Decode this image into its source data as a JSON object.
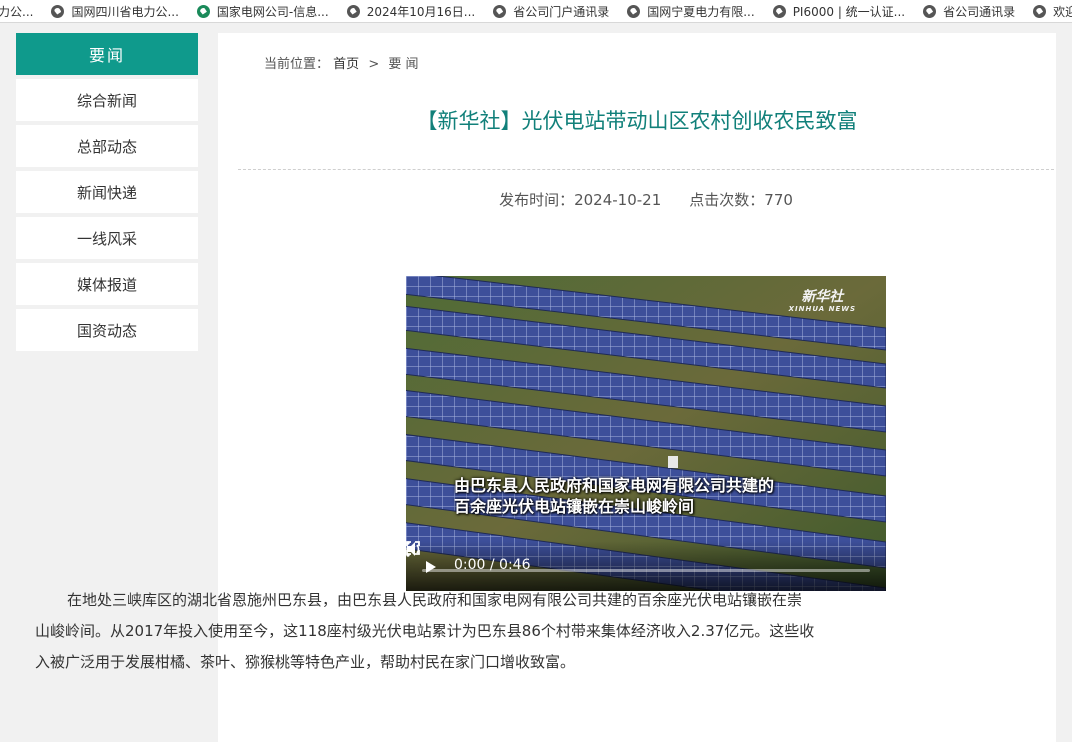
{
  "bookmarks": [
    {
      "label": "力公...",
      "icon": "globe-icon"
    },
    {
      "label": "国网四川省电力公...",
      "icon": "globe-icon"
    },
    {
      "label": "国家电网公司-信息...",
      "icon": "sgcc-logo-icon"
    },
    {
      "label": "2024年10月16日...",
      "icon": "globe-icon"
    },
    {
      "label": "省公司门户通讯录",
      "icon": "globe-icon"
    },
    {
      "label": "国网宁夏电力有限...",
      "icon": "globe-icon"
    },
    {
      "label": "PI6000 | 统一认证...",
      "icon": "globe-icon"
    },
    {
      "label": "省公司通讯录",
      "icon": "globe-icon"
    },
    {
      "label": "欢迎",
      "icon": "globe-icon"
    }
  ],
  "sidebar": {
    "header": "要闻",
    "items": [
      {
        "label": "综合新闻"
      },
      {
        "label": "总部动态"
      },
      {
        "label": "新闻快递"
      },
      {
        "label": "一线风采"
      },
      {
        "label": "媒体报道"
      },
      {
        "label": "国资动态"
      }
    ]
  },
  "breadcrumb": {
    "prefix": "当前位置：",
    "home": "首页",
    "separator": ">",
    "current": "要 闻"
  },
  "article": {
    "title": "【新华社】光伏电站带动山区农村创收农民致富",
    "publish_label": "发布时间：",
    "publish_date": "2024-10-21",
    "views_label": "点击次数：",
    "views": "770",
    "body": "在地处三峡库区的湖北省恩施州巴东县，由巴东县人民政府和国家电网有限公司共建的百余座光伏电站镶嵌在崇山峻岭间。从2017年投入使用至今，这118座村级光伏电站累计为巴东县86个村带来集体经济收入2.37亿元。这些收入被广泛用于发展柑橘、茶叶、猕猴桃等特色产业，帮助村民在家门口增收致富。"
  },
  "video": {
    "watermark": "新华社",
    "watermark_sub": "XINHUA NEWS",
    "subtitle_line1": "由巴东县人民政府和国家电网有限公司共建的",
    "subtitle_line2": "百余座光伏电站镶嵌在崇山峻岭间",
    "time": "0:00 / 0:46",
    "progress": 0
  },
  "colors": {
    "accent": "#0f9a8c",
    "title": "#11807a"
  }
}
